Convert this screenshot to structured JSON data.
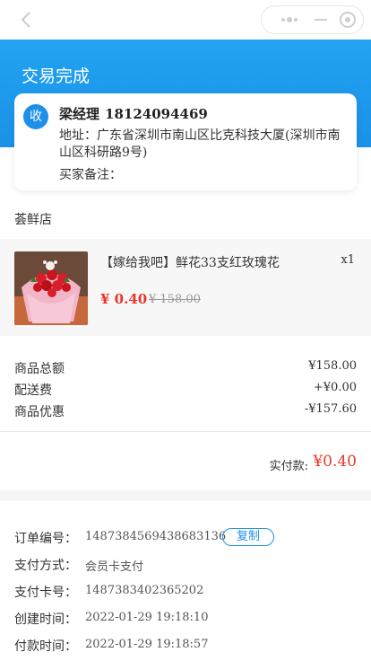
{
  "status": {
    "title": "交易完成"
  },
  "receiver": {
    "badge": "收",
    "name": "梁经理",
    "phone": "18124094469",
    "address_label": "地址：",
    "address": "广东省深圳市南山区比克科技大厦(深圳市南山区科研路9号)",
    "note_label": "买家备注："
  },
  "shop": {
    "name": "荟鲜店"
  },
  "item": {
    "title": "【嫁给我吧】鲜花33支红玫瑰花",
    "qty": "x1",
    "price": "¥ 0.40",
    "original_price": "¥ 158.00"
  },
  "summary": {
    "rows": [
      {
        "label": "商品总额",
        "value": "¥158.00"
      },
      {
        "label": "配送费",
        "value": "+¥0.00"
      },
      {
        "label": "商品优惠",
        "value": "-¥157.60"
      }
    ],
    "paid_label": "实付款:",
    "paid_value": "¥0.40"
  },
  "order_info": {
    "rows": [
      {
        "label": "订单编号：",
        "value": "1487384569438683136"
      },
      {
        "label": "支付方式：",
        "value": "会员卡支付"
      },
      {
        "label": "支付卡号：",
        "value": "1487383402365202"
      },
      {
        "label": "创建时间：",
        "value": "2022-01-29 19:18:10"
      },
      {
        "label": "付款时间：",
        "value": "2022-01-29 19:18:57"
      }
    ],
    "copy_label": "复制"
  },
  "colors": {
    "accent": "#1e90e8",
    "price": "#e8352a",
    "banner": "#22a3f0"
  },
  "icons": {
    "back": "chevron-left-icon",
    "more": "more-dots-icon",
    "minimize": "minimize-icon",
    "close": "target-close-icon"
  }
}
